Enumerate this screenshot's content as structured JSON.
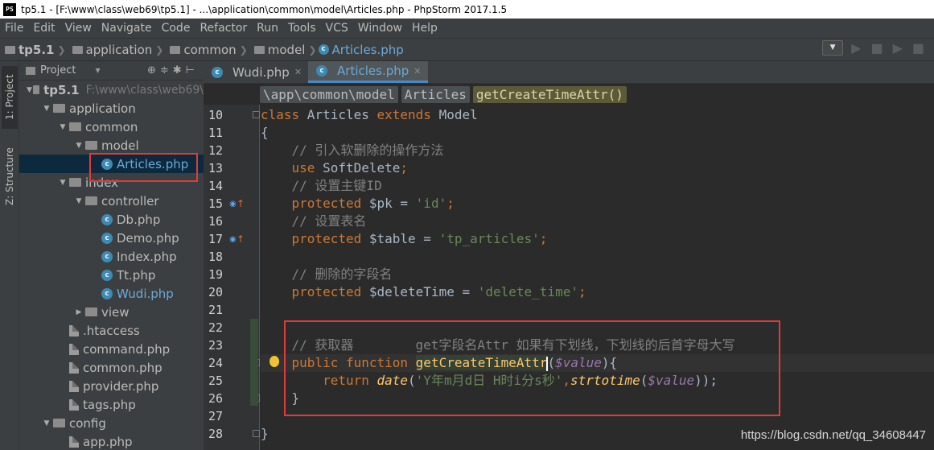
{
  "window": {
    "title": "tp5.1 - [F:\\www\\class\\web69\\tp5.1] - ...\\application\\common\\model\\Articles.php - PhpStorm 2017.1.5",
    "app_icon_text": "PS"
  },
  "menu": [
    "File",
    "Edit",
    "View",
    "Navigate",
    "Code",
    "Refactor",
    "Run",
    "Tools",
    "VCS",
    "Window",
    "Help"
  ],
  "navbar": {
    "crumbs": [
      "tp5.1",
      "application",
      "common",
      "model"
    ],
    "file": "Articles.php"
  },
  "left_strip": {
    "project_tab": "1: Project",
    "structure_tab": "Z: Structure"
  },
  "project_panel": {
    "title": "Project",
    "tree": [
      {
        "label": "tp5.1",
        "path": "F:\\www\\class\\web69\\",
        "kind": "folder",
        "depth": 0,
        "expanded": true,
        "bold": true
      },
      {
        "label": "application",
        "kind": "folder",
        "depth": 1,
        "expanded": true
      },
      {
        "label": "common",
        "kind": "folder",
        "depth": 2,
        "expanded": true
      },
      {
        "label": "model",
        "kind": "folder",
        "depth": 3,
        "expanded": true
      },
      {
        "label": "Articles.php",
        "kind": "php",
        "depth": 4,
        "selected": true,
        "blue": true
      },
      {
        "label": "index",
        "kind": "folder",
        "depth": 2,
        "expanded": true
      },
      {
        "label": "controller",
        "kind": "folder",
        "depth": 3,
        "expanded": true
      },
      {
        "label": "Db.php",
        "kind": "php",
        "depth": 4
      },
      {
        "label": "Demo.php",
        "kind": "php",
        "depth": 4
      },
      {
        "label": "Index.php",
        "kind": "php",
        "depth": 4
      },
      {
        "label": "Tt.php",
        "kind": "php",
        "depth": 4
      },
      {
        "label": "Wudi.php",
        "kind": "php",
        "depth": 4,
        "blue": true
      },
      {
        "label": "view",
        "kind": "folder",
        "depth": 3,
        "expanded": false
      },
      {
        "label": ".htaccess",
        "kind": "generic",
        "depth": 2
      },
      {
        "label": "command.php",
        "kind": "generic",
        "depth": 2
      },
      {
        "label": "common.php",
        "kind": "generic",
        "depth": 2
      },
      {
        "label": "provider.php",
        "kind": "generic",
        "depth": 2
      },
      {
        "label": "tags.php",
        "kind": "generic",
        "depth": 2
      },
      {
        "label": "config",
        "kind": "folder",
        "depth": 1,
        "expanded": true
      },
      {
        "label": "app.php",
        "kind": "generic",
        "depth": 2
      }
    ]
  },
  "editor": {
    "tabs": [
      {
        "label": "Wudi.php",
        "active": false
      },
      {
        "label": "Articles.php",
        "active": true
      }
    ],
    "breadcrumbs": [
      "\\app\\common\\model",
      "Articles",
      "getCreateTimeAttr()"
    ],
    "line_numbers": [
      "10",
      "11",
      "12",
      "13",
      "14",
      "15",
      "16",
      "17",
      "18",
      "19",
      "20",
      "21",
      "22",
      "23",
      "24",
      "25",
      "26",
      "27",
      "28"
    ],
    "code": {
      "l10": {
        "kw1": "class",
        "name": " Articles ",
        "kw2": "extends",
        "parent": " Model"
      },
      "l11": "{",
      "l12": "    // 引入软删除的操作方法",
      "l13": {
        "kw": "    use",
        "rest": " SoftDelete",
        "semi": ";"
      },
      "l14": "    // 设置主键ID",
      "l15": {
        "kw": "    protected",
        "var": " $pk ",
        "op": "= ",
        "str": "'id'",
        "semi": ";"
      },
      "l16": "    // 设置表名",
      "l17": {
        "kw": "    protected",
        "var": " $table ",
        "op": "= ",
        "str": "'tp_articles'",
        "semi": ";"
      },
      "l19": "    // 删除的字段名",
      "l20": {
        "kw": "    protected",
        "var": " $deleteTime ",
        "op": "= ",
        "str": "'delete_time'",
        "semi": ";"
      },
      "l23": {
        "comment": "    // 获取器",
        "note": "        get字段名Attr 如果有下划线，下划线的后首字母大写"
      },
      "l24": {
        "kw1": "    public",
        "kw2": " function",
        "fn": "getCreateTimeAttr",
        "open": "(",
        "param": "$value",
        "close": "){"
      },
      "l25": {
        "kw": "        return",
        "fn1": "date",
        "p1": "(",
        "str": "'Y年m月d日 H时i分s秒'",
        "comma": ",",
        "fn2": "strtotime",
        "p2": "(",
        "param": "$value",
        "end": "));"
      },
      "l26": "    }",
      "l28": "}"
    }
  },
  "watermark": "https://blog.csdn.net/qq_34608447"
}
